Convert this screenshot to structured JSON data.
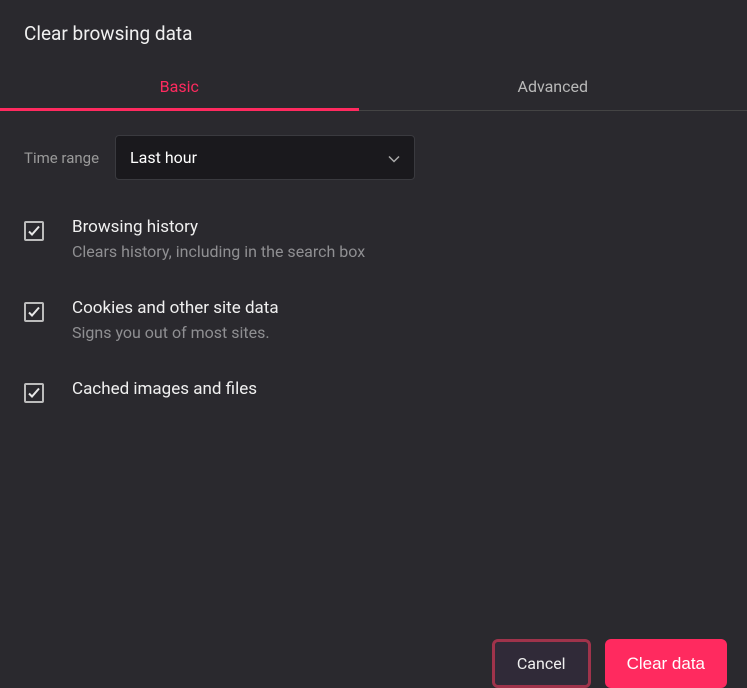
{
  "title": "Clear browsing data",
  "tabs": {
    "basic": "Basic",
    "advanced": "Advanced"
  },
  "timeRange": {
    "label": "Time range",
    "value": "Last hour"
  },
  "items": {
    "history": {
      "title": "Browsing history",
      "desc": "Clears history, including in the search box"
    },
    "cookies": {
      "title": "Cookies and other site data",
      "desc": "Signs you out of most sites."
    },
    "cache": {
      "title": "Cached images and files"
    }
  },
  "buttons": {
    "cancel": "Cancel",
    "clear": "Clear data"
  }
}
